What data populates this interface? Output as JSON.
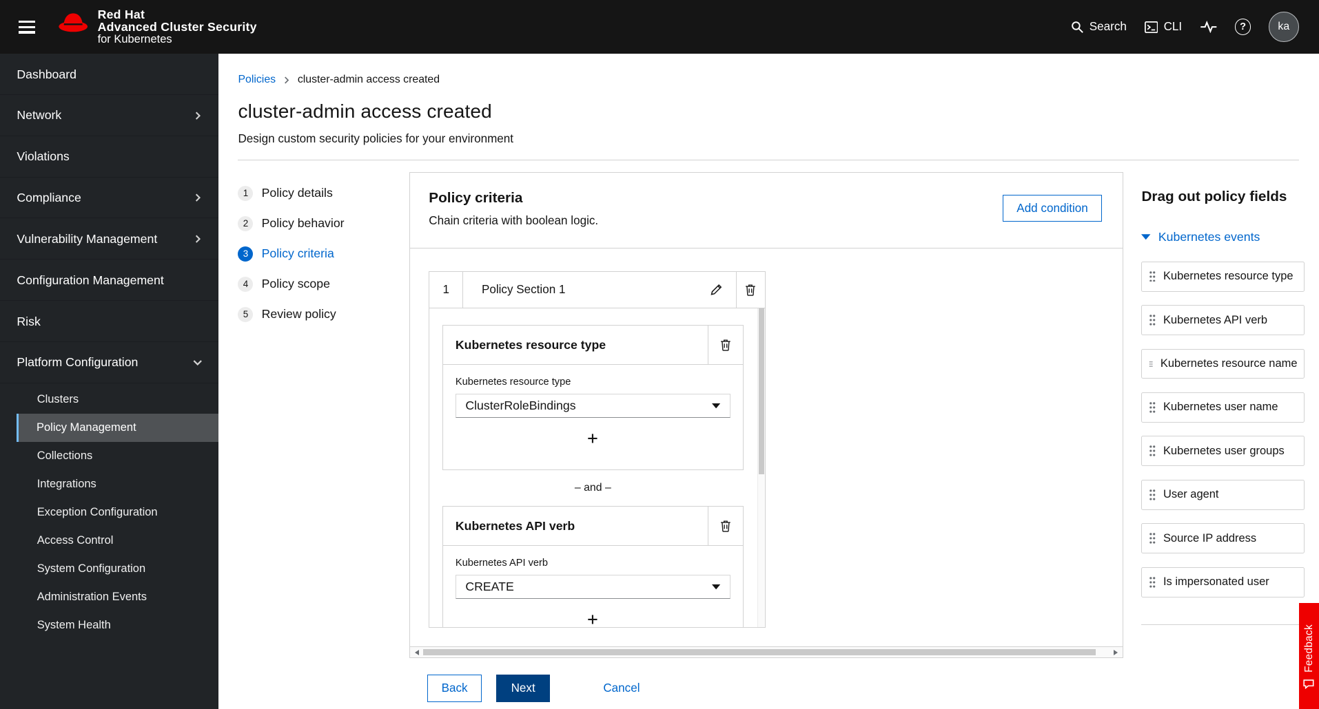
{
  "masthead": {
    "brand_line1": "Red Hat",
    "brand_line2": "Advanced Cluster Security",
    "brand_line3": "for Kubernetes",
    "search_label": "Search",
    "cli_label": "CLI",
    "avatar_initials": "ka"
  },
  "icons": {
    "help_glyph": "?"
  },
  "sidebar": {
    "items": [
      {
        "label": "Dashboard"
      },
      {
        "label": "Network"
      },
      {
        "label": "Violations"
      },
      {
        "label": "Compliance"
      },
      {
        "label": "Vulnerability Management"
      },
      {
        "label": "Configuration Management"
      },
      {
        "label": "Risk"
      },
      {
        "label": "Platform Configuration"
      }
    ],
    "platform_children": [
      "Clusters",
      "Policy Management",
      "Collections",
      "Integrations",
      "Exception Configuration",
      "Access Control",
      "System Configuration",
      "Administration Events",
      "System Health"
    ],
    "selected": "Policy Management"
  },
  "breadcrumb": {
    "parent": "Policies",
    "current": "cluster-admin access created"
  },
  "page": {
    "title": "cluster-admin access created",
    "subtitle": "Design custom security policies for your environment"
  },
  "wizard": {
    "steps": [
      {
        "num": "1",
        "label": "Policy details"
      },
      {
        "num": "2",
        "label": "Policy behavior"
      },
      {
        "num": "3",
        "label": "Policy criteria"
      },
      {
        "num": "4",
        "label": "Policy scope"
      },
      {
        "num": "5",
        "label": "Review policy"
      }
    ],
    "active_step": "Policy criteria"
  },
  "criteria": {
    "heading": "Policy criteria",
    "description": "Chain criteria with boolean logic.",
    "add_condition_label": "Add condition",
    "section": {
      "index": "1",
      "title": "Policy Section 1",
      "joiner": "– and –",
      "cards": [
        {
          "title": "Kubernetes resource type",
          "field_label": "Kubernetes resource type",
          "value": "ClusterRoleBindings"
        },
        {
          "title": "Kubernetes API verb",
          "field_label": "Kubernetes API verb",
          "value": "CREATE"
        }
      ]
    },
    "footer": {
      "back": "Back",
      "next": "Next",
      "cancel": "Cancel"
    }
  },
  "drag_panel": {
    "title": "Drag out policy fields",
    "group_label": "Kubernetes events",
    "fields": [
      "Kubernetes resource type",
      "Kubernetes API verb",
      "Kubernetes resource name",
      "Kubernetes user name",
      "Kubernetes user groups",
      "User agent",
      "Source IP address",
      "Is impersonated user"
    ]
  },
  "feedback": {
    "label": "Feedback"
  },
  "colors": {
    "accent": "#0066cc",
    "masthead_bg": "#151515",
    "sidebar_bg": "#212427",
    "nav_selected_bg": "#4f5255",
    "nav_selected_border": "#73bcf7",
    "primary_button_bg": "#004080",
    "feedback_bg": "#ee0000",
    "border": "#d2d2d2"
  }
}
